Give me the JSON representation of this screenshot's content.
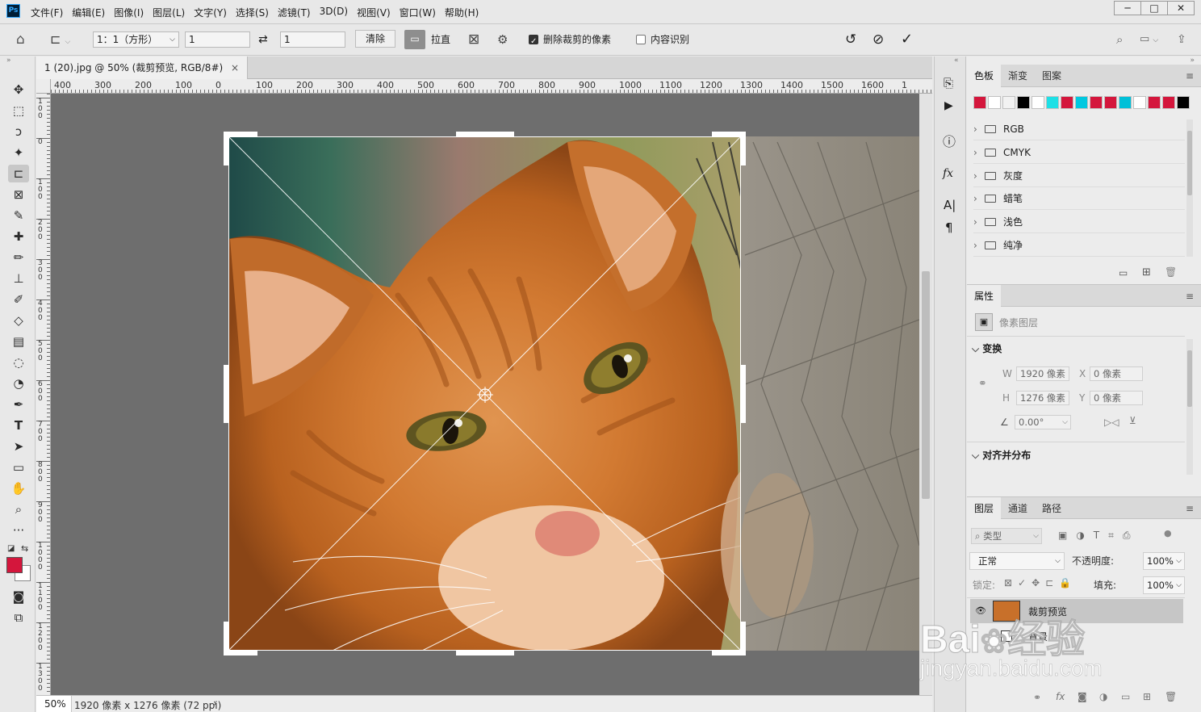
{
  "app": {
    "logo": "Ps"
  },
  "menubar": {
    "items": [
      "文件(F)",
      "编辑(E)",
      "图像(I)",
      "图层(L)",
      "文字(Y)",
      "选择(S)",
      "滤镜(T)",
      "3D(D)",
      "视图(V)",
      "窗口(W)",
      "帮助(H)"
    ]
  },
  "window_controls": {
    "minimize": "─",
    "maximize": "□",
    "close": "✕"
  },
  "options": {
    "ratio": "1：1（方形）",
    "width": "1",
    "height": "1",
    "clear": "清除",
    "straighten": "拉直",
    "delete_cropped": "删除裁剪的像素",
    "delete_cropped_checked": true,
    "content_aware": "内容识别",
    "content_aware_checked": false
  },
  "document": {
    "tab_title": "1 (20).jpg @ 50% (裁剪预览, RGB/8#)",
    "tab_close": "×",
    "zoom": "50%",
    "info": "1920 像素 x 1276 像素 (72 ppi)",
    "hruler_labels": [
      "400",
      "300",
      "200",
      "100",
      "0",
      "100",
      "200",
      "300",
      "400",
      "500",
      "600",
      "700",
      "800",
      "900",
      "1000",
      "1100",
      "1200",
      "1300",
      "1400",
      "1500",
      "1600",
      "1"
    ],
    "vruler_labels": [
      "100",
      "0",
      "100",
      "200",
      "300",
      "400",
      "500",
      "600",
      "700",
      "800",
      "900",
      "1000",
      "1100",
      "1200",
      "1300"
    ]
  },
  "swatches": {
    "tabs": [
      "色板",
      "渐变",
      "图案"
    ],
    "colors": [
      "#d4163c",
      "#ffffff",
      "#f2f2f2",
      "#000000",
      "#ffffff",
      "#1ee0e6",
      "#d4163c",
      "#00c8e0",
      "#d4163c",
      "#d4163c",
      "#00c0d8",
      "#ffffff",
      "#d4163c",
      "#d4163c",
      "#000000"
    ],
    "groups": [
      "RGB",
      "CMYK",
      "灰度",
      "蜡笔",
      "浅色",
      "纯净"
    ]
  },
  "properties": {
    "tab": "属性",
    "layer_type": "像素图层",
    "transform_title": "变换",
    "w_label": "W",
    "w_value": "1920 像素",
    "h_label": "H",
    "h_value": "1276 像素",
    "x_label": "X",
    "x_value": "0 像素",
    "y_label": "Y",
    "y_value": "0 像素",
    "angle": "0.00°",
    "align_title": "对齐并分布"
  },
  "layers": {
    "tabs": [
      "图层",
      "通道",
      "路径"
    ],
    "filter": "类型",
    "blend_mode": "正常",
    "opacity_label": "不透明度:",
    "opacity": "100%",
    "lock_label": "锁定:",
    "fill_label": "填充:",
    "fill": "100%",
    "items": [
      {
        "name": "裁剪预览",
        "visible": true,
        "selected": true
      },
      {
        "name": "背景",
        "visible": false,
        "selected": false
      }
    ]
  },
  "watermark": {
    "brand": "Bai",
    "brand2": "经验",
    "url": "jingyan.baidu.com"
  }
}
